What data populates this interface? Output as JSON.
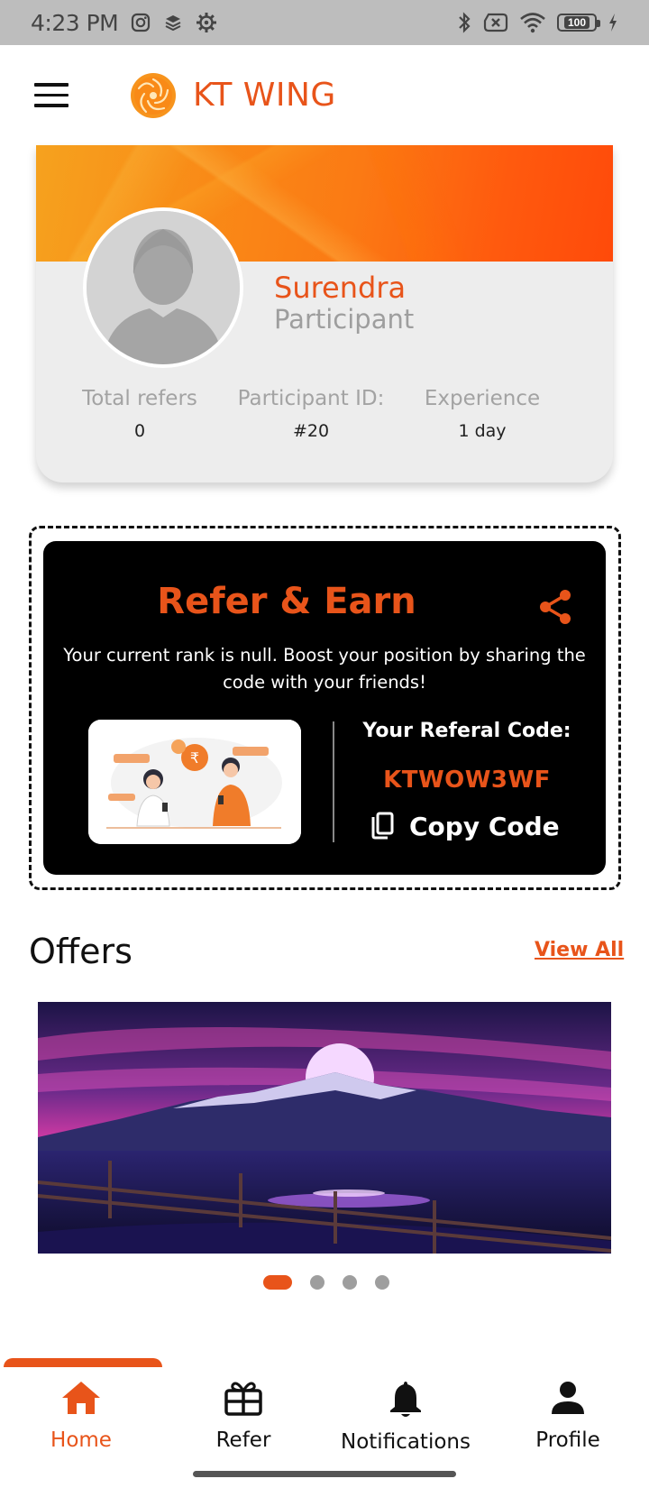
{
  "status_bar": {
    "time": "4:23 PM",
    "battery": "100"
  },
  "app_bar": {
    "title": "KT WING"
  },
  "profile": {
    "name": "Surendra",
    "role": "Participant",
    "stats": [
      {
        "label": "Total refers",
        "value": "0"
      },
      {
        "label": "Participant ID:",
        "value": "#20"
      },
      {
        "label": "Experience",
        "value": "1 day"
      }
    ]
  },
  "refer": {
    "title": "Refer & Earn",
    "description": "Your current rank is null. Boost your position by sharing the code with your friends!",
    "code_label": "Your Referal Code:",
    "code": "KTWOW3WF",
    "copy_label": "Copy Code"
  },
  "offers": {
    "title": "Offers",
    "view_all": "View All",
    "slide_count": 4,
    "active_slide": 1
  },
  "bottom_nav": {
    "items": [
      {
        "label": "Home",
        "icon": "home-icon",
        "active": true
      },
      {
        "label": "Refer",
        "icon": "gift-icon",
        "active": false
      },
      {
        "label": "Notifications",
        "icon": "bell-icon",
        "active": false
      },
      {
        "label": "Profile",
        "icon": "person-icon",
        "active": false
      }
    ]
  },
  "colors": {
    "accent": "#e8541a",
    "card_bg": "#ededed",
    "refer_bg": "#000000"
  }
}
